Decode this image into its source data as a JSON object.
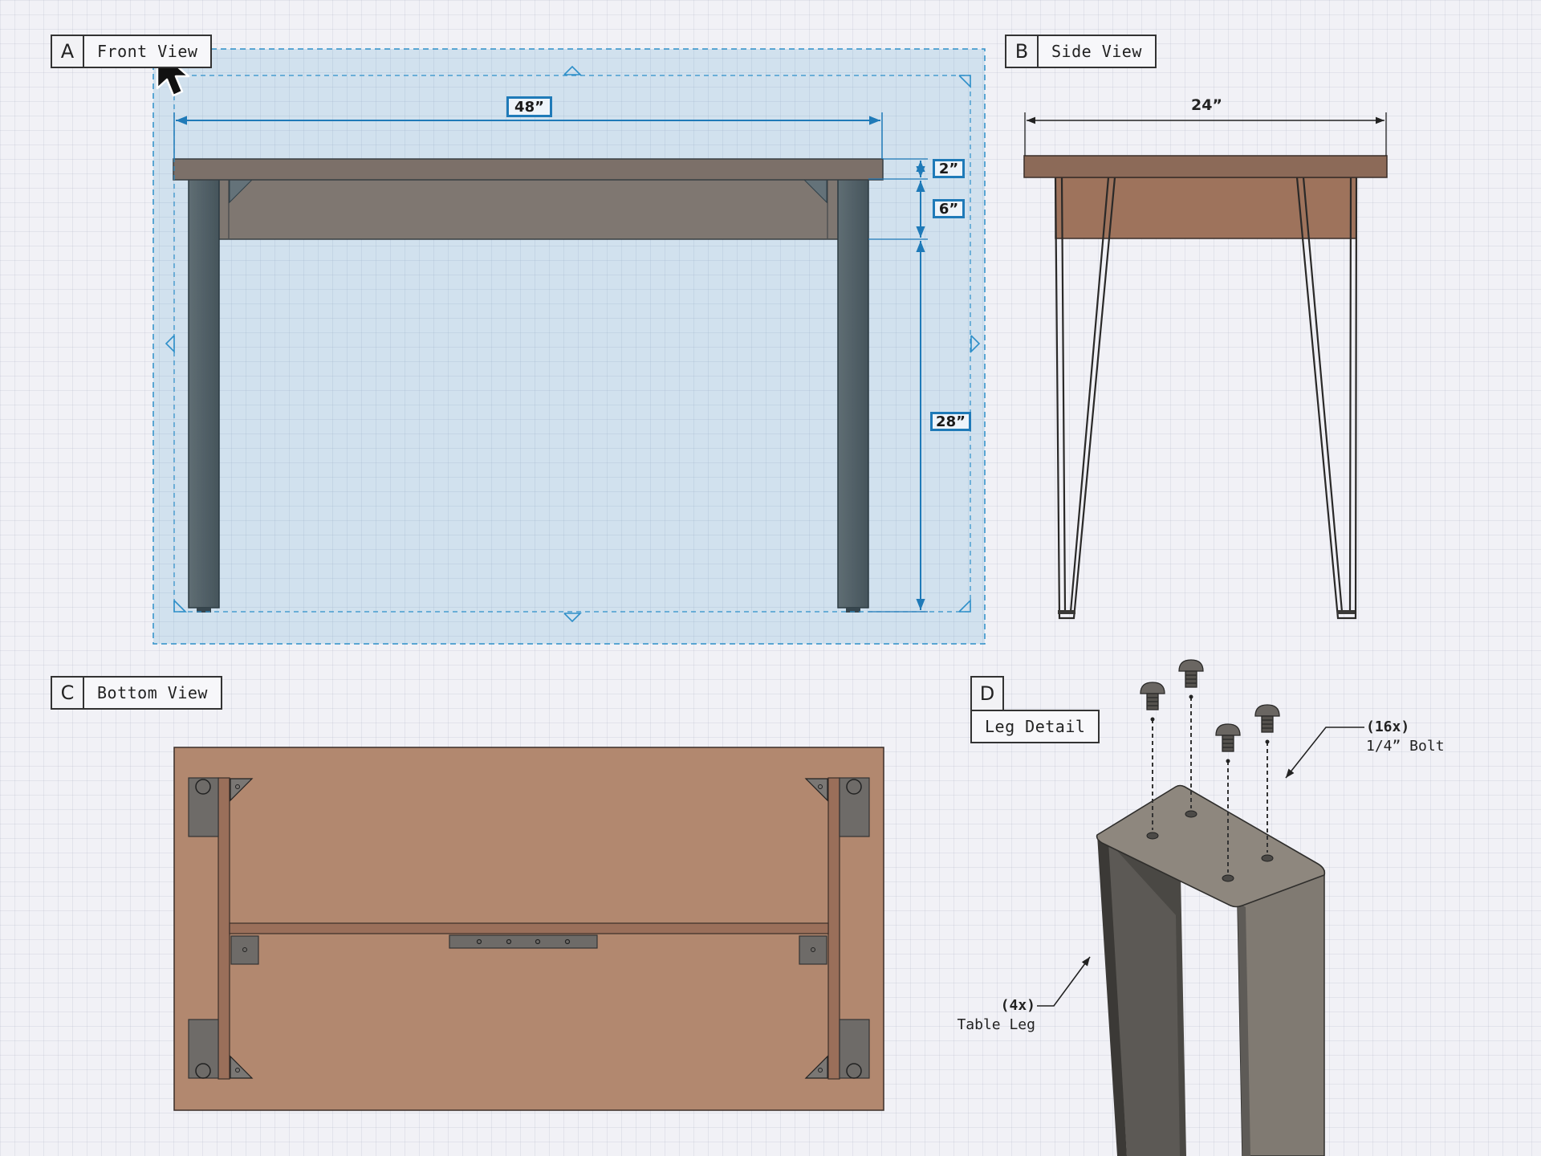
{
  "panels": [
    {
      "letter": "A",
      "title": "Front View"
    },
    {
      "letter": "B",
      "title": "Side View"
    },
    {
      "letter": "C",
      "title": "Bottom View"
    },
    {
      "letter": "D",
      "title": "Leg Detail"
    }
  ],
  "dimensions": {
    "front_width": "48”",
    "top_thickness": "2”",
    "apron_height": "6”",
    "leg_height": "28”",
    "side_depth": "24”"
  },
  "callouts": {
    "bolt": {
      "qty": "(16x)",
      "label": "1/4” Bolt"
    },
    "leg": {
      "qty": "(4x)",
      "label": "Table Leg"
    }
  },
  "colors": {
    "wood_top": "#8c6a58",
    "apron": "#8f7361",
    "bottom_panel": "#b2886f",
    "leg_steel": "#5e5c58",
    "selection_blue": "#2e8fc9",
    "dimension_blue": "#1f7ab8"
  },
  "icons": [
    "cursor-icon",
    "resize-handle-icon",
    "bolt-icon"
  ]
}
